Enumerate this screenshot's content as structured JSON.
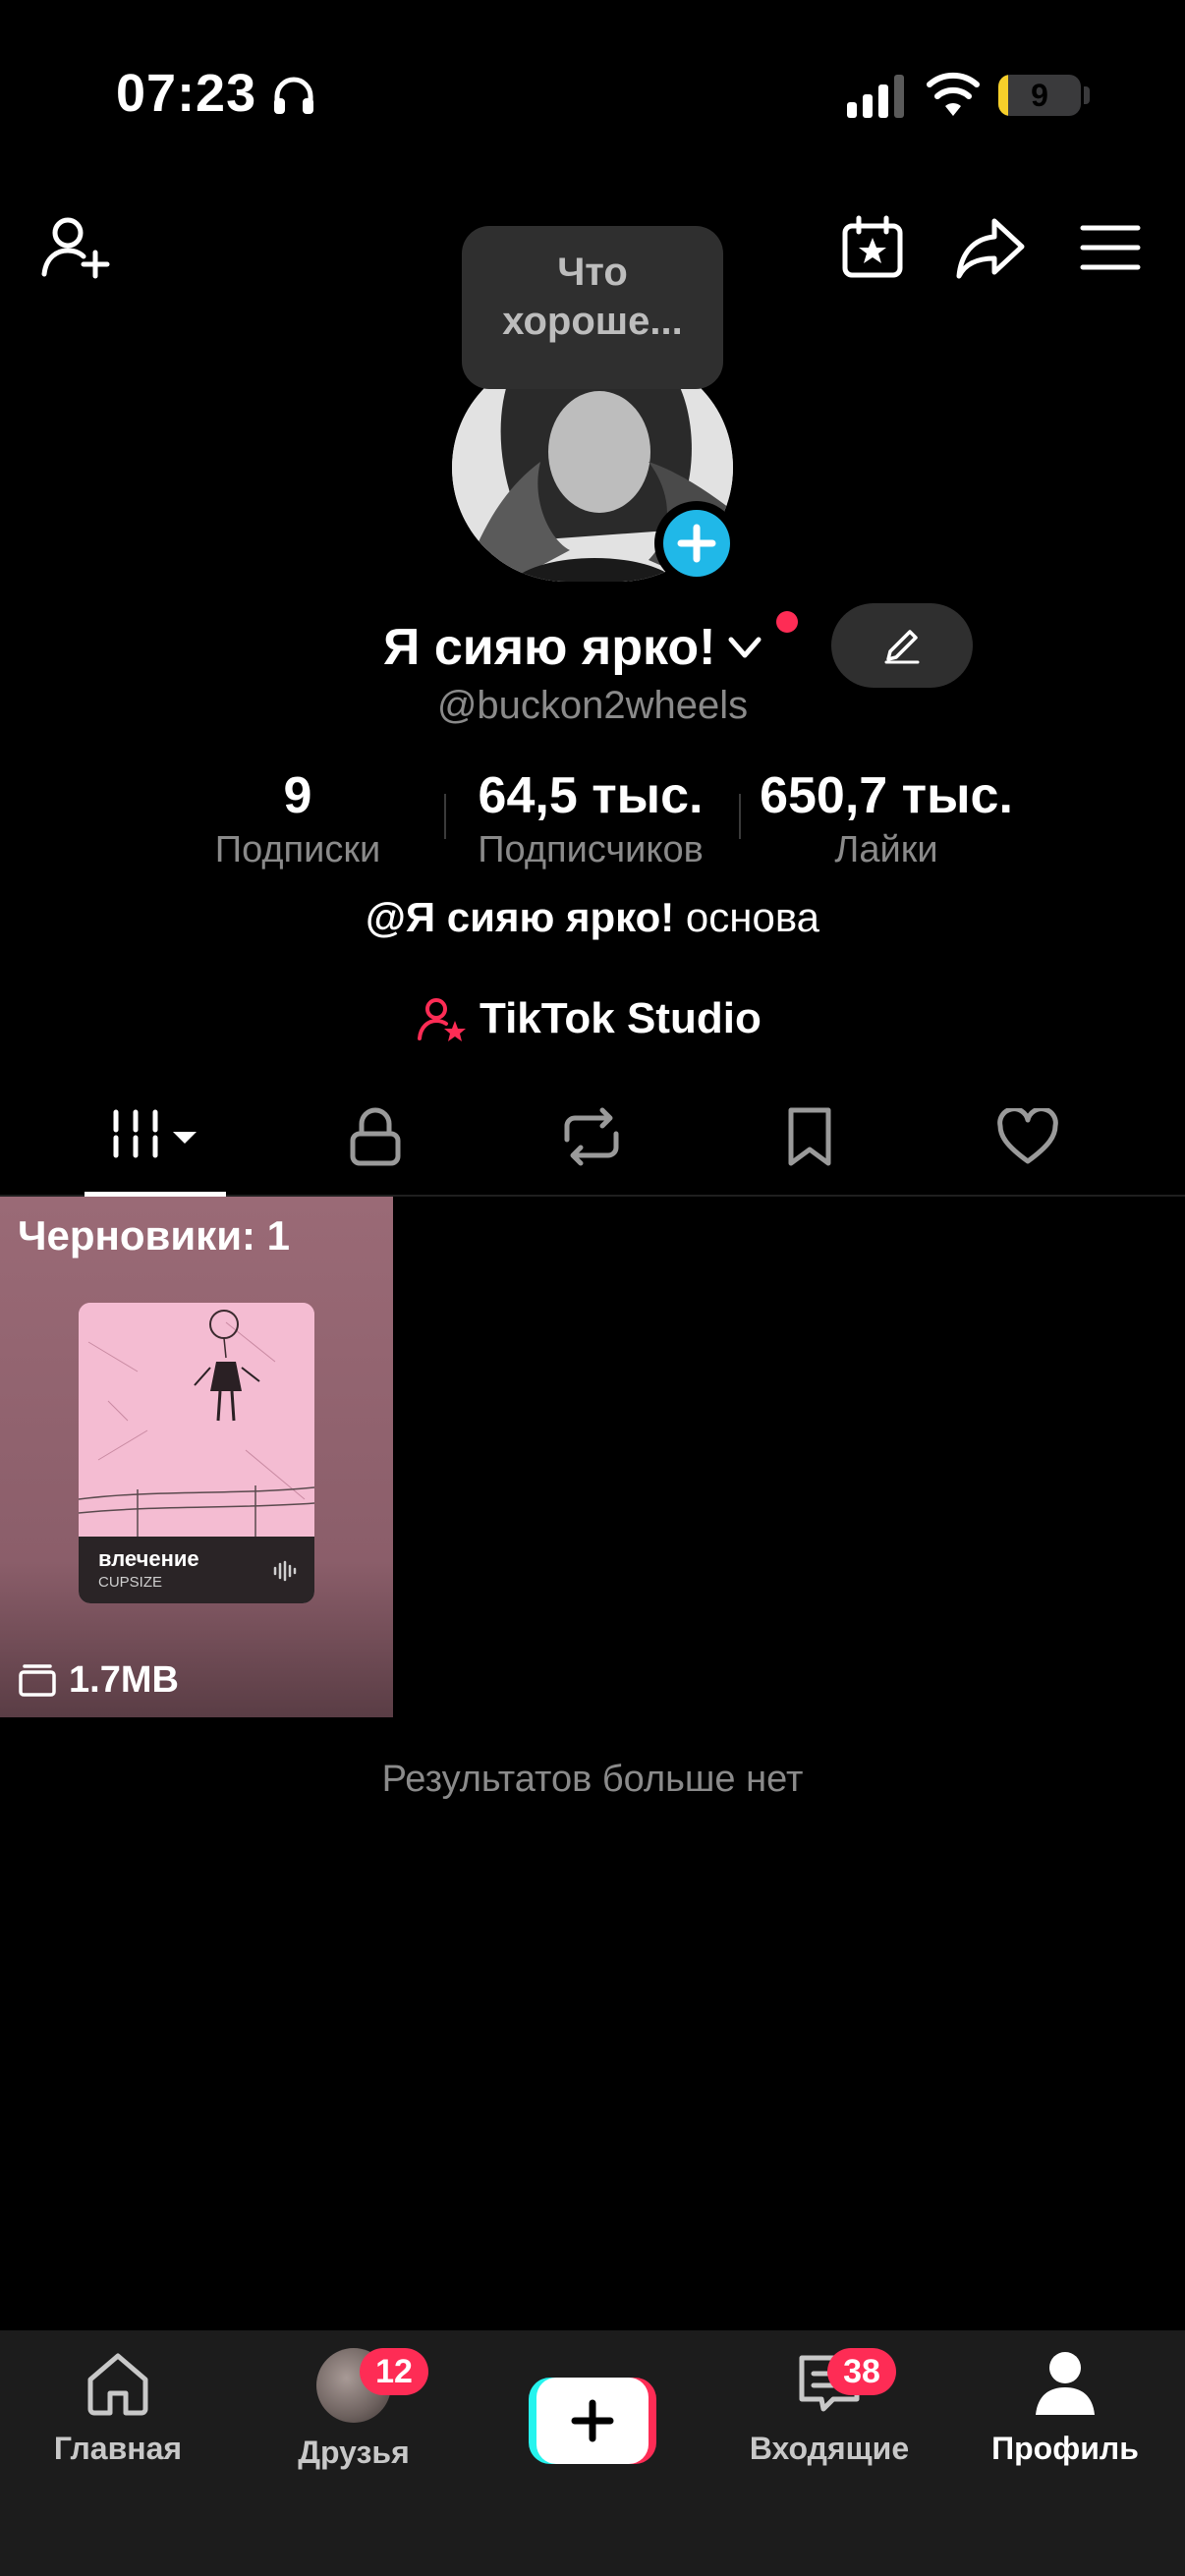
{
  "status_bar": {
    "time": "07:23",
    "battery_level": "9",
    "icons": [
      "headphones-icon",
      "signal-icon",
      "wifi-icon",
      "battery-icon"
    ]
  },
  "top_bar": {
    "icons": [
      "add-friend-icon",
      "calendar-star-icon",
      "share-icon",
      "menu-icon"
    ]
  },
  "profile": {
    "note_bubble": "Что хороше...",
    "display_name": "Я сияю ярко!",
    "username": "@buckon2wheels",
    "stats": {
      "following_value": "9",
      "following_label": "Подписки",
      "followers_value": "64,5 тыс.",
      "followers_label": "Подписчиков",
      "likes_value": "650,7 тыс.",
      "likes_label": "Лайки"
    },
    "bio_mention": "@Я сияю ярко!",
    "bio_text": " основа",
    "studio_label": "TikTok Studio"
  },
  "tabs": [
    "videos-grid-icon",
    "lock-icon",
    "repost-icon",
    "bookmark-icon",
    "heart-icon"
  ],
  "drafts": {
    "label": "Черновики: 1",
    "cover_song": "влечение",
    "cover_artist": "CUPSIZE",
    "size": "1.7MB"
  },
  "no_more_results": "Результатов больше нет",
  "bottom_nav": {
    "home": "Главная",
    "friends": "Друзья",
    "friends_badge": "12",
    "inbox": "Входящие",
    "inbox_badge": "38",
    "profile": "Профиль"
  },
  "colors": {
    "accent_red": "#fe2c55",
    "accent_cyan": "#25f4ee",
    "avatar_add_blue": "#20b8e8",
    "muted_text": "#8a8a8a"
  }
}
